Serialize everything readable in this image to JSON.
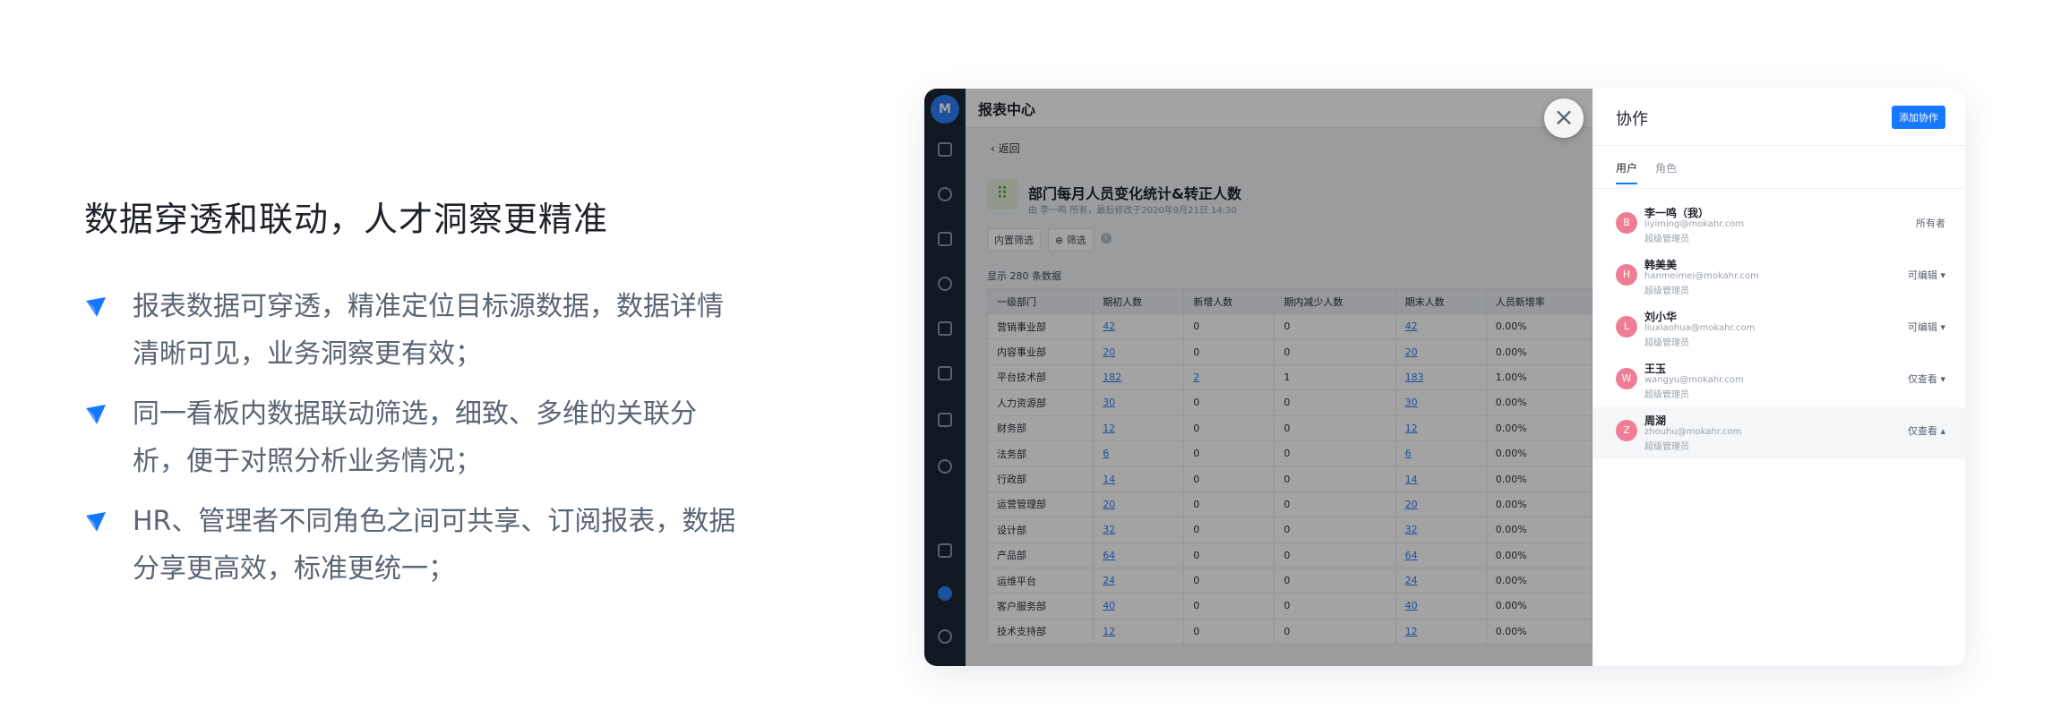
{
  "marketing": {
    "heading": "数据穿透和联动，人才洞察更精准",
    "bullets": [
      "报表数据可穿透，精准定位目标源数据，数据详情清晰可见，业务洞察更有效；",
      "同一看板内数据联动筛选，细致、多维的关联分析，便于对照分析业务情况；",
      "HR、管理者不同角色之间可共享、订阅报表，数据分享更高效，标准更统一；"
    ],
    "bullet_color": "#1677ff"
  },
  "app": {
    "header_title": "报表中心",
    "back_label": "返回",
    "report_title": "部门每月人员变化统计&转正人数",
    "report_meta": "由 李一鸣 所有，最后修改于2020年9月21日 14:30",
    "filter_internal": "内置筛选",
    "filter_label": "筛选",
    "row_count": "显示 280 条数据",
    "columns": [
      "一级部门",
      "期初人数",
      "新增人数",
      "期内减少人数",
      "期末人数",
      "人员新增率"
    ],
    "rows": [
      [
        "营销事业部",
        "42",
        "0",
        "0",
        "42",
        "0.00%"
      ],
      [
        "内容事业部",
        "20",
        "0",
        "0",
        "20",
        "0.00%"
      ],
      [
        "平台技术部",
        "182",
        "2",
        "1",
        "183",
        "1.00%"
      ],
      [
        "人力资源部",
        "30",
        "0",
        "0",
        "30",
        "0.00%"
      ],
      [
        "财务部",
        "12",
        "0",
        "0",
        "12",
        "0.00%"
      ],
      [
        "法务部",
        "6",
        "0",
        "0",
        "6",
        "0.00%"
      ],
      [
        "行政部",
        "14",
        "0",
        "0",
        "14",
        "0.00%"
      ],
      [
        "运营管理部",
        "20",
        "0",
        "0",
        "20",
        "0.00%"
      ],
      [
        "设计部",
        "32",
        "0",
        "0",
        "32",
        "0.00%"
      ],
      [
        "产品部",
        "64",
        "0",
        "0",
        "64",
        "0.00%"
      ],
      [
        "运维平台",
        "24",
        "0",
        "0",
        "24",
        "0.00%"
      ],
      [
        "客户服务部",
        "40",
        "0",
        "0",
        "40",
        "0.00%"
      ],
      [
        "技术支持部",
        "12",
        "0",
        "0",
        "12",
        "0.00%"
      ]
    ],
    "close_icon": "close-icon"
  },
  "panel": {
    "title": "协作",
    "add_button": "添加协作",
    "tabs": [
      "用户",
      "角色"
    ],
    "users": [
      {
        "avatar": "B",
        "name": "李一鸣（我）",
        "email": "liyiming@mokahr.com",
        "role": "超级管理员",
        "permission": "所有者"
      },
      {
        "avatar": "H",
        "name": "韩美美",
        "email": "hanmeimei@mokahr.com",
        "role": "超级管理员",
        "permission": "可编辑 ▾"
      },
      {
        "avatar": "L",
        "name": "刘小华",
        "email": "liuxiaohua@mokahr.com",
        "role": "超级管理员",
        "permission": "可编辑 ▾"
      },
      {
        "avatar": "W",
        "name": "王玉",
        "email": "wangyu@mokahr.com",
        "role": "超级管理员",
        "permission": "仅查看 ▾"
      },
      {
        "avatar": "Z",
        "name": "周湖",
        "email": "zhouhu@mokahr.com",
        "role": "超级管理员",
        "permission": "仅查看 ▴"
      }
    ]
  }
}
